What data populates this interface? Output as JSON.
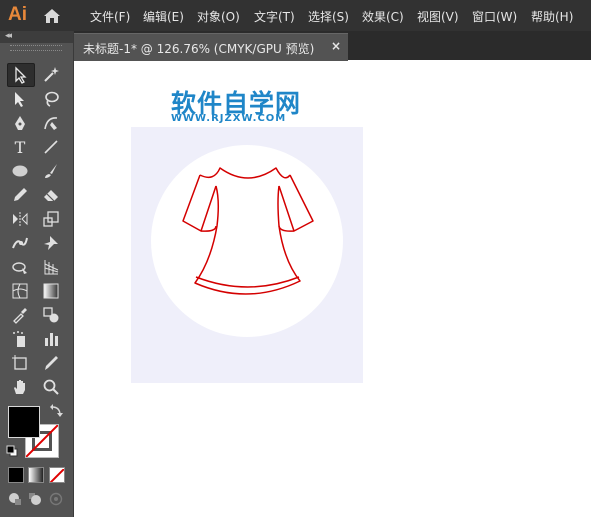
{
  "app": {
    "logo_text": "Ai"
  },
  "menu": [
    {
      "label": "文件(F)"
    },
    {
      "label": "编辑(E)"
    },
    {
      "label": "对象(O)"
    },
    {
      "label": "文字(T)"
    },
    {
      "label": "选择(S)"
    },
    {
      "label": "效果(C)"
    },
    {
      "label": "视图(V)"
    },
    {
      "label": "窗口(W)"
    },
    {
      "label": "帮助(H)"
    }
  ],
  "document_tab": {
    "title": "未标题-1* @ 126.76% (CMYK/GPU 预览)",
    "close_glyph": "×"
  },
  "toolpanel": {
    "collapse_glyph": "◂◂"
  },
  "tools": [
    {
      "icon": "selection-tool-icon"
    },
    {
      "icon": "magic-wand-tool-icon"
    },
    {
      "icon": "direct-selection-tool-icon"
    },
    {
      "icon": "lasso-tool-icon"
    },
    {
      "icon": "pen-tool-icon"
    },
    {
      "icon": "curvature-tool-icon"
    },
    {
      "icon": "type-tool-icon",
      "glyph": "T"
    },
    {
      "icon": "line-tool-icon"
    },
    {
      "icon": "ellipse-tool-icon"
    },
    {
      "icon": "paintbrush-tool-icon"
    },
    {
      "icon": "pencil-tool-icon"
    },
    {
      "icon": "eraser-tool-icon"
    },
    {
      "icon": "reflect-tool-icon"
    },
    {
      "icon": "scale-tool-icon"
    },
    {
      "icon": "puppet-warp-tool-icon"
    },
    {
      "icon": "pin-tool-icon"
    },
    {
      "icon": "shape-builder-tool-icon"
    },
    {
      "icon": "perspective-grid-tool-icon"
    },
    {
      "icon": "mesh-tool-icon"
    },
    {
      "icon": "gradient-tool-icon"
    },
    {
      "icon": "eyedropper-tool-icon"
    },
    {
      "icon": "blend-tool-icon"
    },
    {
      "icon": "symbol-sprayer-tool-icon"
    },
    {
      "icon": "column-graph-tool-icon"
    },
    {
      "icon": "artboard-tool-icon"
    },
    {
      "icon": "slice-tool-icon"
    },
    {
      "icon": "hand-tool-icon"
    },
    {
      "icon": "zoom-tool-icon"
    }
  ],
  "colors": {
    "fill": "#000000",
    "stroke": "none",
    "artboard_bg": "#efeffa",
    "shirt_stroke": "#d40000",
    "watermark": "#1f86c8"
  },
  "watermark": {
    "title": "软件自学网",
    "url": "WWW.RJZXW.COM"
  }
}
